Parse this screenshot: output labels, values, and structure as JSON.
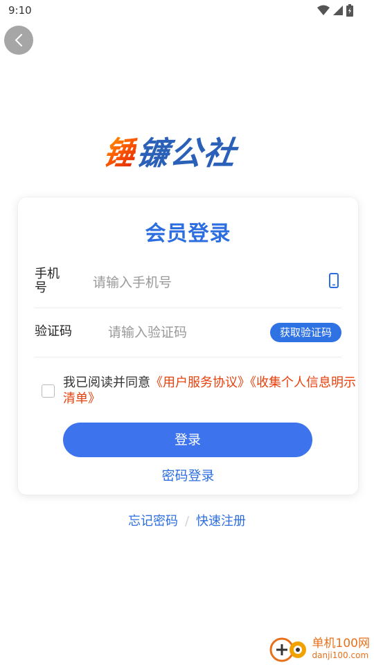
{
  "status_bar": {
    "time": "9:10"
  },
  "brand": {
    "logo_chars": [
      "锤",
      "镰",
      "公",
      "社"
    ]
  },
  "card": {
    "title": "会员登录",
    "phone": {
      "label": "手机号",
      "placeholder": "请输入手机号"
    },
    "code": {
      "label": "验证码",
      "placeholder": "请输入验证码",
      "get_code_label": "获取验证码"
    },
    "agreement": {
      "prefix": "我已阅读并同意",
      "link_user_agreement": "《用户服务协议》",
      "link_privacy": "《收集个人信息明示清单》"
    },
    "login_label": "登录",
    "password_login_label": "密码登录"
  },
  "bottom": {
    "forgot_password": "忘记密码",
    "separator": "/",
    "quick_register": "快速注册"
  },
  "watermark": {
    "site_name": "单机100网",
    "site_url": "danji100.com"
  },
  "colors": {
    "primary": "#2c6ee0",
    "button": "#3d74ee",
    "link_red": "#e8400c"
  }
}
